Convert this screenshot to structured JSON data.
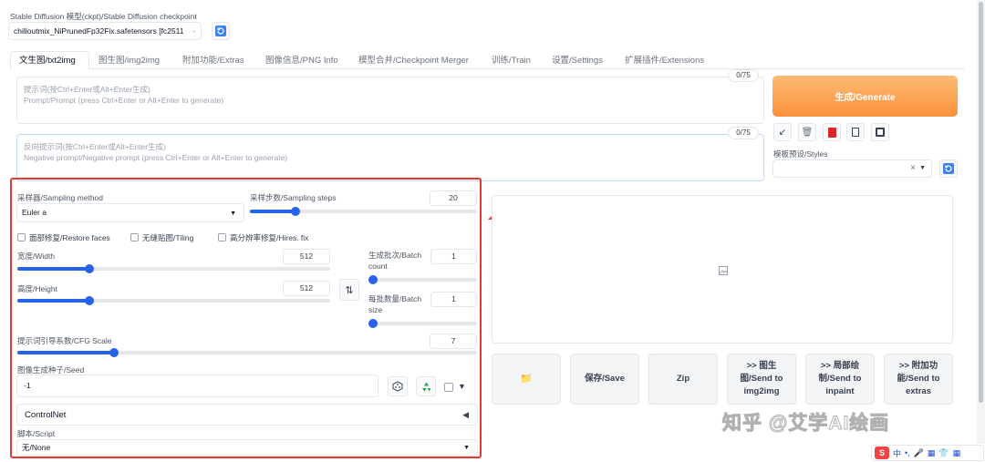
{
  "checkpoint": {
    "label": "Stable Diffusion 模型(ckpt)/Stable Diffusion checkpoint",
    "value": "chilloutmix_NiPrunedFp32Fix.safetensors [fc2511",
    "arrow": "-"
  },
  "tabs": [
    {
      "label": "文生图/txt2img"
    },
    {
      "label": "图生图/img2img"
    },
    {
      "label": "附加功能/Extras"
    },
    {
      "label": "图像信息/PNG Info"
    },
    {
      "label": "模型合并/Checkpoint Merger"
    },
    {
      "label": "训练/Train"
    },
    {
      "label": "设置/Settings"
    },
    {
      "label": "扩展插件/Extensions"
    }
  ],
  "prompt": {
    "counter": "0/75",
    "placeholder_line1": "提示词(按Ctrl+Enter或Alt+Enter生成)",
    "placeholder_line2": "Prompt/Prompt (press Ctrl+Enter or Alt+Enter to generate)"
  },
  "negative_prompt": {
    "counter": "0/75",
    "placeholder_line1": "反向提示词(按Ctrl+Enter或Alt+Enter生成)",
    "placeholder_line2": "Negative prompt/Negative prompt (press Ctrl+Enter or Alt+Enter to generate)"
  },
  "generate_label": "生成/Generate",
  "styles": {
    "label": "模板预设/Styles",
    "clear": "×"
  },
  "sampling": {
    "method_label": "采样器/Sampling method",
    "method_value": "Euler a",
    "steps_label": "采样步数/Sampling steps",
    "steps_value": "20",
    "steps_fraction": 0.2
  },
  "options": {
    "restore_faces": "面部修复/Restore faces",
    "tiling": "无缝贴图/Tiling",
    "hires_fix": "高分辨率修复/Hires. fix"
  },
  "width": {
    "label": "宽度/Width",
    "value": "512",
    "fraction": 0.23
  },
  "height": {
    "label": "高度/Height",
    "value": "512",
    "fraction": 0.23
  },
  "swap_label": "⇅",
  "batch_count": {
    "label_line1": "生成批次/Batch",
    "label_line2": "count",
    "value": "1",
    "fraction": 0.0
  },
  "batch_size": {
    "label_line1": "每批数量/Batch",
    "label_line2": "size",
    "value": "1",
    "fraction": 0.0
  },
  "cfg": {
    "label": "提示词引导系数/CFG Scale",
    "value": "7",
    "fraction": 0.21
  },
  "seed": {
    "label": "图像生成种子/Seed",
    "value": "-1",
    "expand": "▼"
  },
  "controlnet": {
    "label": "ControlNet",
    "toggle": "◀"
  },
  "script": {
    "label": "脚本/Script",
    "value": "无/None"
  },
  "actions": {
    "folder": "📁",
    "save": "保存/Save",
    "zip": "Zip",
    "send_img2img": [
      ">> 图生",
      "图/Send to",
      "img2img"
    ],
    "send_inpaint": [
      ">> 局部绘",
      "制/Send to",
      "inpaint"
    ],
    "send_extras": [
      ">> 附加功",
      "能/Send to",
      "extras"
    ]
  },
  "watermark": "知乎 @艾学AI绘画",
  "ime_bar": [
    "S",
    "中",
    "•,",
    "🎤",
    "▦",
    "👕",
    "▦"
  ],
  "colors": {
    "accent": "#2563eb",
    "generate": "#f97316",
    "annotation": "#e53935"
  }
}
